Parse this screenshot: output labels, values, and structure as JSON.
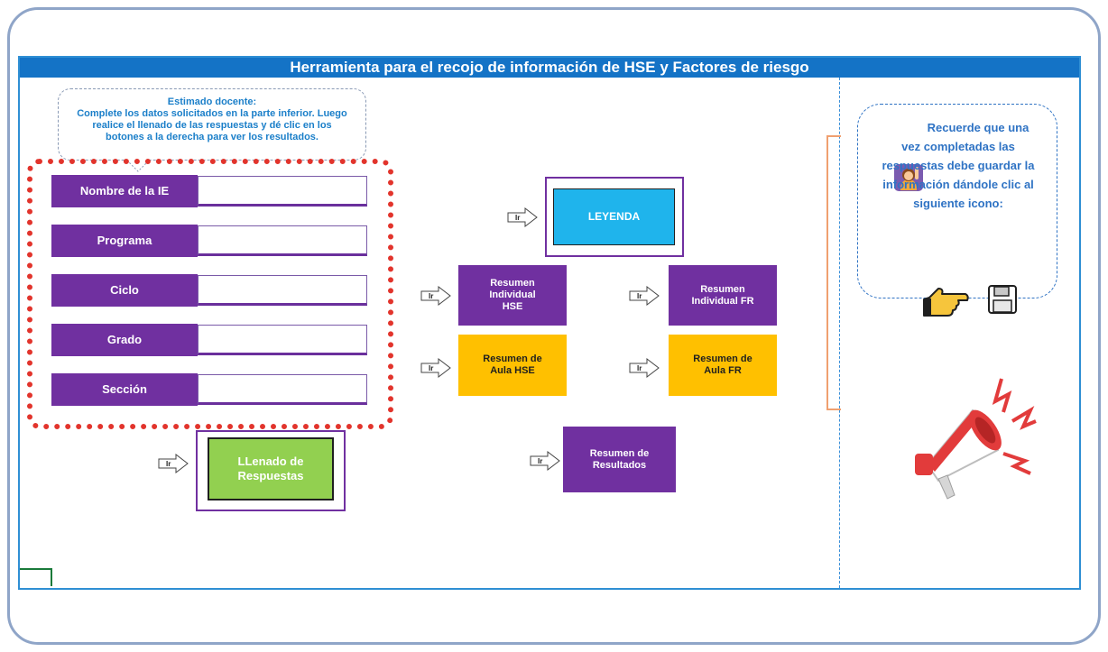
{
  "title": "Herramienta para el recojo de información de HSE y Factores de riesgo",
  "instructions": {
    "heading": "Estimado docente:",
    "line1": "Complete los datos solicitados en la parte inferior. Luego",
    "line2": "realice el llenado de las respuestas y dé clic en los",
    "line3": "botones a la derecha para ver los resultados."
  },
  "fields": [
    {
      "label": "Nombre de la IE",
      "value": ""
    },
    {
      "label": "Programa",
      "value": ""
    },
    {
      "label": "Ciclo",
      "value": ""
    },
    {
      "label": "Grado",
      "value": ""
    },
    {
      "label": "Sección",
      "value": ""
    }
  ],
  "arrow_label": "Ir",
  "buttons": {
    "llenado": "LLenado de Respuestas",
    "leyenda": "LEYENDA",
    "resumen_ind_hse": "Resumen Individual HSE",
    "resumen_ind_fr": "Resumen Individual FR",
    "resumen_aula_hse": "Resumen de Aula HSE",
    "resumen_aula_fr": "Resumen de Aula FR",
    "resumen_resultados": "Resumen de Resultados"
  },
  "reminder": {
    "line1": "Recuerde que una",
    "line2": "vez completadas las",
    "line3": "respuestas debe  guardar la",
    "line4": "información dándole clic al",
    "line5": "siguiente icono:"
  },
  "icons": [
    "woman-raising-hand-icon",
    "pointing-hand-icon",
    "floppy-disk-icon",
    "megaphone-icon"
  ],
  "colors": {
    "purple": "#7030a0",
    "gold": "#ffc000",
    "blue_title": "#1473c6",
    "leyenda": "#1fb4ec",
    "green": "#92d050",
    "red_dots": "#e2342c"
  }
}
